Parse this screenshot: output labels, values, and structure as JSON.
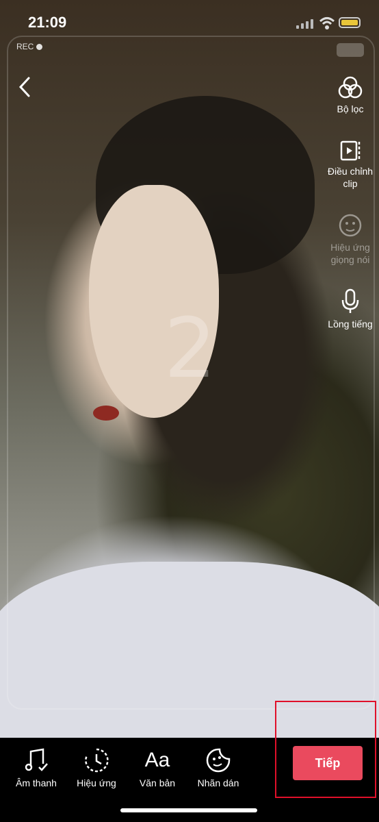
{
  "status_bar": {
    "time": "21:09"
  },
  "camera_overlay": {
    "rec_label": "REC",
    "countdown_number": "2"
  },
  "right_toolbar": {
    "filters_label": "Bộ lọc",
    "adjust_clip_label": "Điều chỉnh\nclip",
    "voice_effects_label": "Hiệu ứng\ngiọng nói",
    "voiceover_label": "Lồng tiếng"
  },
  "bottom_bar": {
    "sounds_label": "Âm thanh",
    "effects_label": "Hiệu ứng",
    "text_label": "Văn bản",
    "text_icon_glyph": "Aa",
    "stickers_label": "Nhãn dán",
    "next_label": "Tiếp"
  },
  "colors": {
    "accent": "#ea4a5e",
    "highlight_border": "#e0102a",
    "battery": "#e9c63a"
  },
  "icons": [
    "back-chevron-icon",
    "filters-icon",
    "adjust-clip-icon",
    "voice-effects-icon",
    "microphone-icon",
    "music-note-icon",
    "effects-timer-icon",
    "sticker-icon"
  ]
}
